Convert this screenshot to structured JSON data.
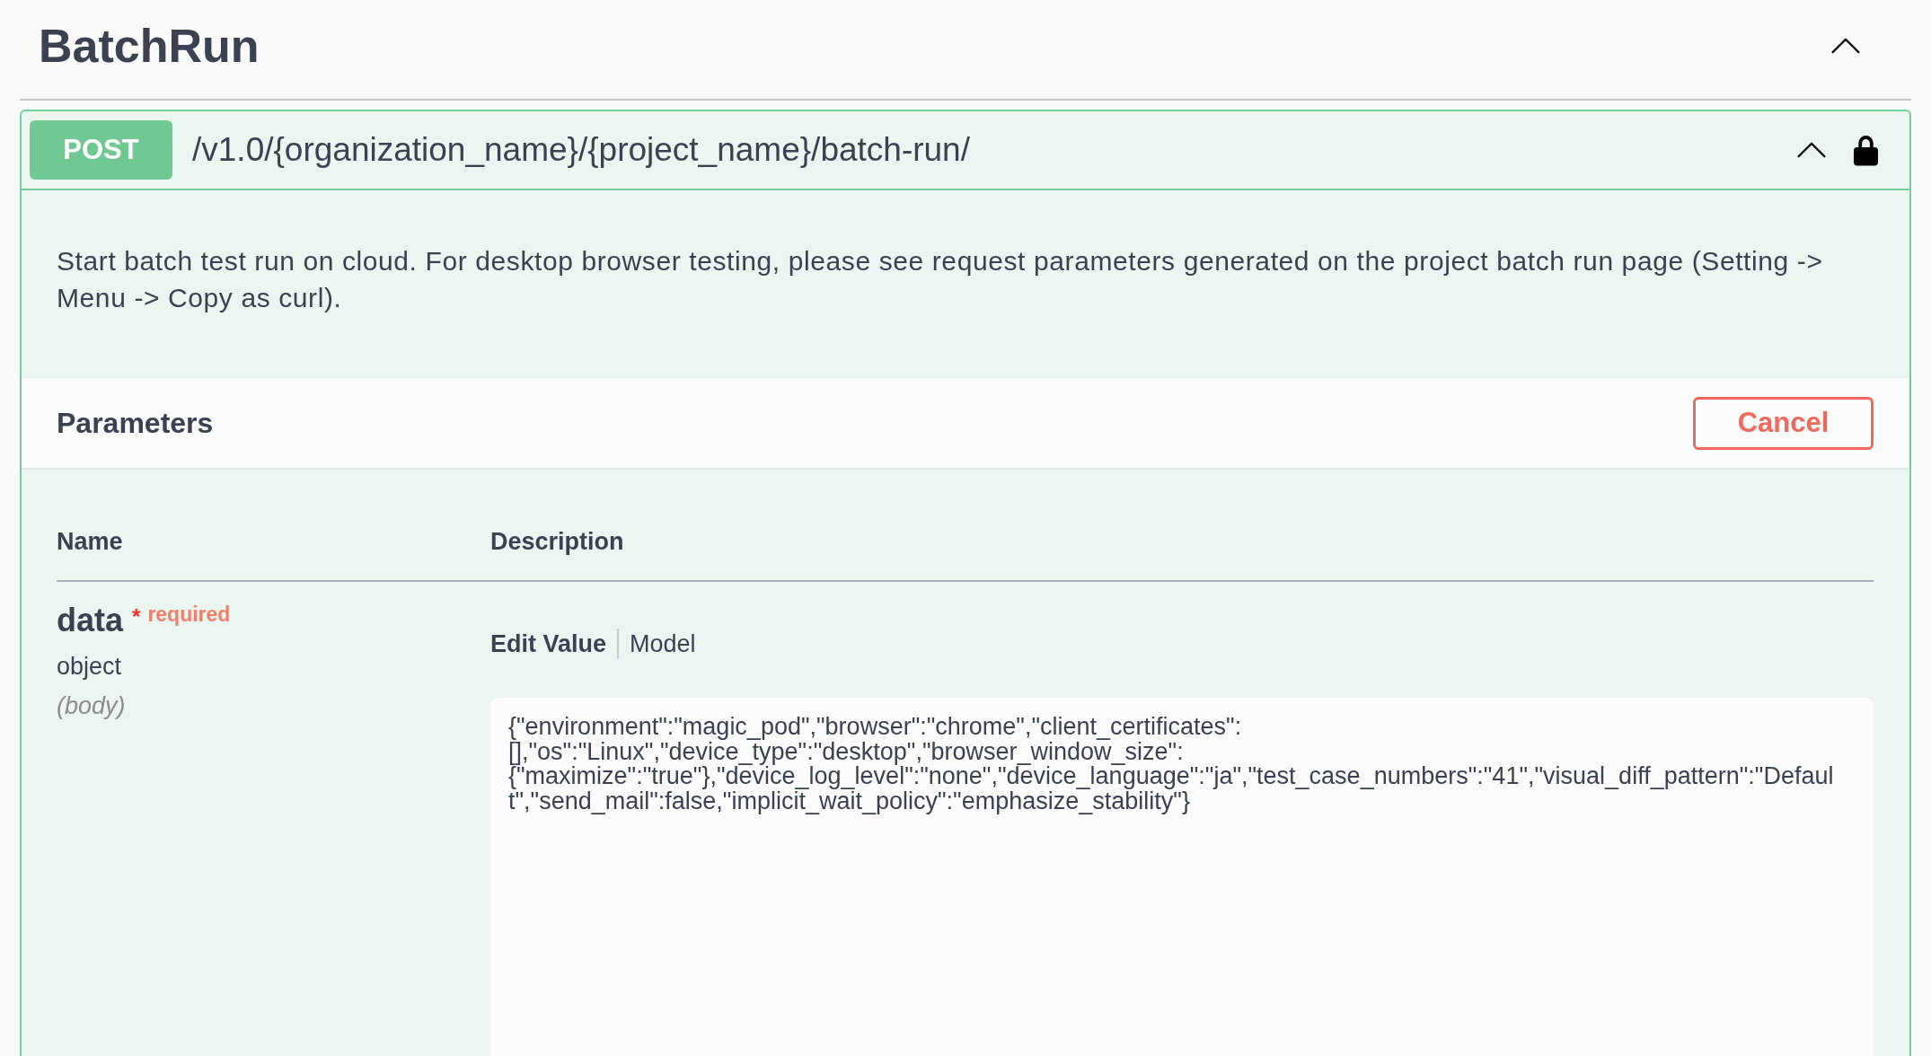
{
  "section": {
    "title": "BatchRun",
    "expanded": true
  },
  "operation": {
    "method": "POST",
    "path": "/v1.0/{organization_name}/{project_name}/batch-run/",
    "expanded": true,
    "locked": true,
    "description": "Start batch test run on cloud. For desktop browser testing, please see request parameters generated on the project batch run page (Setting -> Menu -> Copy as curl).",
    "parameters": {
      "title": "Parameters",
      "cancel_button": "Cancel",
      "columns": [
        "Name",
        "Description"
      ],
      "rows": [
        {
          "name": "data",
          "required_mark": "*",
          "required_label": "required",
          "type": "object",
          "location": "(body)",
          "tabs": [
            {
              "label": "Edit Value",
              "selected": true
            },
            {
              "label": "Model",
              "selected": false
            }
          ],
          "value": "{\"environment\":\"magic_pod\",\"browser\":\"chrome\",\"client_certificates\":[],\"os\":\"Linux\",\"device_type\":\"desktop\",\"browser_window_size\":{\"maximize\":\"true\"},\"device_log_level\":\"none\",\"device_language\":\"ja\",\"test_case_numbers\":\"41\",\"visual_diff_pattern\":\"Default\",\"send_mail\":false,\"implicit_wait_policy\":\"emphasize_stability\"}"
        }
      ]
    }
  }
}
